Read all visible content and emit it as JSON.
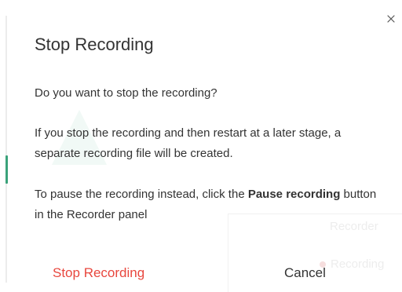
{
  "background": {
    "recorder_label": "Recorder",
    "recording_label": "Recording"
  },
  "dialog": {
    "title": "Stop Recording",
    "close_icon": "close-icon",
    "question": "Do you want to stop the recording?",
    "info": "If you stop the recording and then restart at a later stage, a separate recording file will be created.",
    "pause_hint": {
      "prefix": "To pause the recording instead, click the ",
      "emphasis": "Pause recording",
      "suffix": " button in the Recorder panel"
    },
    "stop_button": "Stop Recording",
    "cancel_button": "Cancel"
  },
  "colors": {
    "danger": "#e8473e",
    "text": "#333333",
    "accent": "#3aa27a"
  }
}
